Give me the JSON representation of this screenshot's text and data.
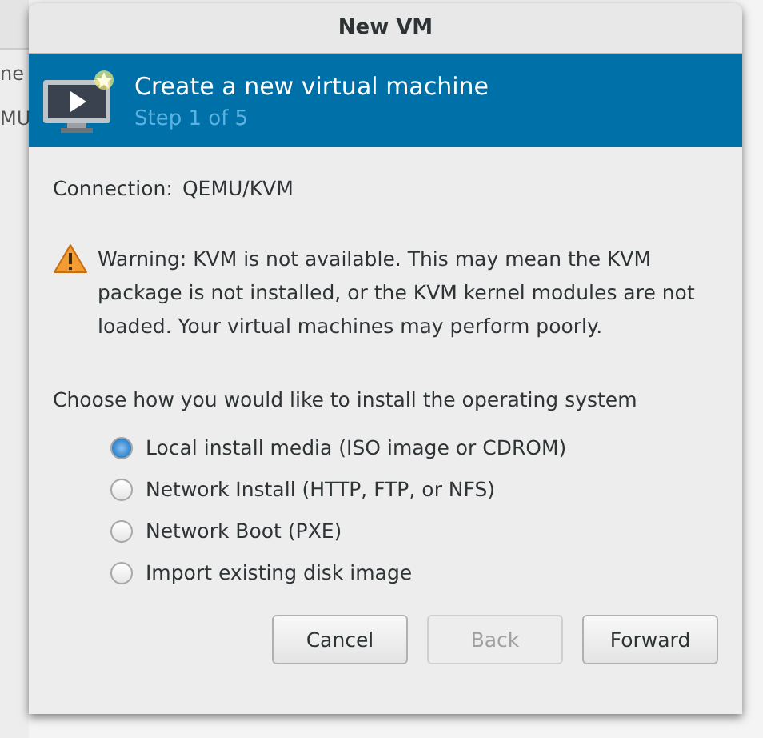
{
  "background_window": {
    "texts": [
      "ne",
      "MU"
    ]
  },
  "window": {
    "title": "New VM"
  },
  "banner": {
    "title": "Create a new virtual machine",
    "subtitle": "Step 1 of 5"
  },
  "connection": {
    "label": "Connection:",
    "value": "QEMU/KVM"
  },
  "warning": {
    "text": "Warning: KVM is not available. This may mean the KVM package is not installed, or the KVM kernel modules are not loaded. Your virtual machines may perform poorly."
  },
  "install_prompt": "Choose how you would like to install the operating system",
  "install_options": [
    {
      "label": "Local install media (ISO image or CDROM)",
      "selected": true
    },
    {
      "label": "Network Install (HTTP, FTP, or NFS)",
      "selected": false
    },
    {
      "label": "Network Boot (PXE)",
      "selected": false
    },
    {
      "label": "Import existing disk image",
      "selected": false
    }
  ],
  "buttons": [
    {
      "label": "Cancel",
      "disabled": false
    },
    {
      "label": "Back",
      "disabled": true
    },
    {
      "label": "Forward",
      "disabled": false
    }
  ]
}
